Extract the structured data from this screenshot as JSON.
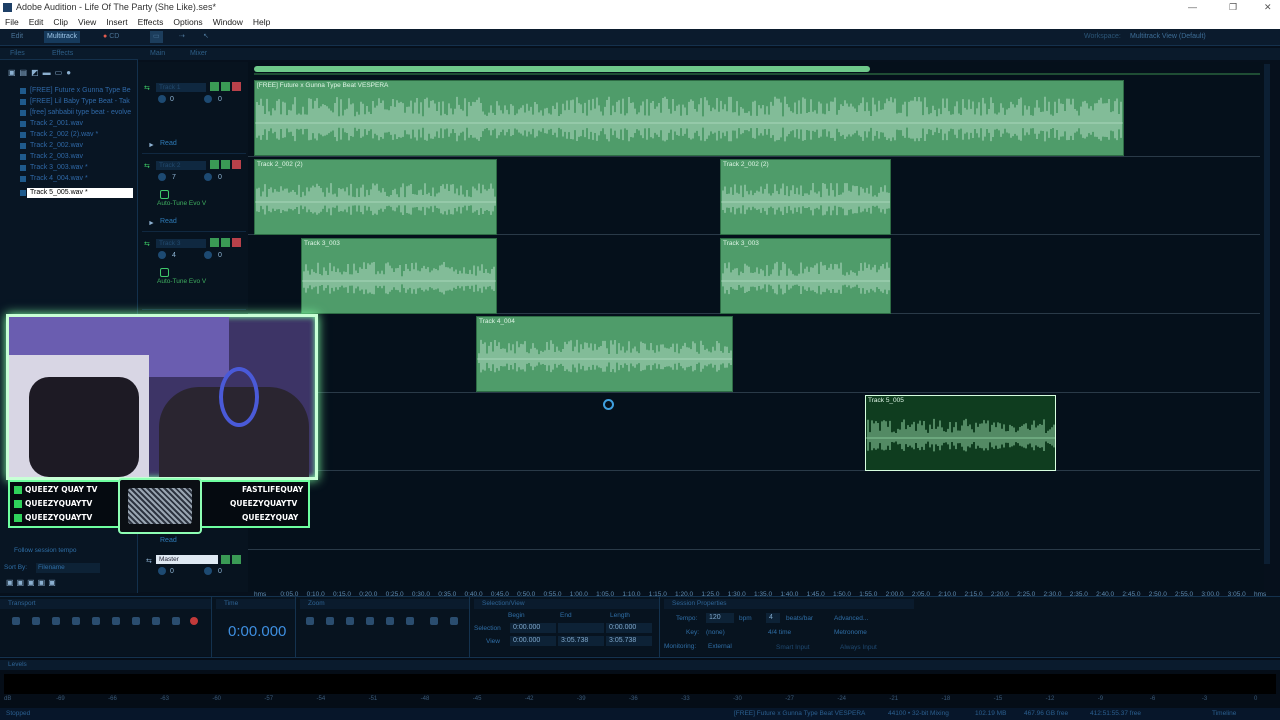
{
  "window": {
    "title": "Adobe Audition - Life Of The Party (She Like).ses*"
  },
  "menu": [
    "File",
    "Edit",
    "Clip",
    "View",
    "Insert",
    "Effects",
    "Options",
    "Window",
    "Help"
  ],
  "toolbar": {
    "edit": "Edit",
    "multitrack": "Multitrack",
    "cd": "CD",
    "workspace_label": "Workspace:",
    "workspace_value": "Multitrack View (Default)"
  },
  "left_panel": {
    "tabs": [
      "Files",
      "Effects"
    ],
    "files": [
      "[FREE] Future x Gunna Type Be",
      "[FREE] Lil Baby Type Beat - Tak",
      "[free] sahbabii type beat - evolve",
      "Track 2_001.wav",
      "Track 2_002 (2).wav *",
      "Track 2_002.wav",
      "Track 2_003.wav",
      "Track 3_003.wav *",
      "Track 4_004.wav *",
      "Track 5_005.wav *"
    ],
    "follow_tempo": "Follow session tempo",
    "sort_by_label": "Sort By:",
    "sort_by_value": "Filename"
  },
  "main_tabs": [
    "Main",
    "Mixer"
  ],
  "tracks": [
    {
      "name": "Track 1",
      "vol": "0",
      "pan": "0",
      "fx": "",
      "read": "Read"
    },
    {
      "name": "Track 2",
      "vol": "7",
      "pan": "0",
      "fx": "Auto-Tune Evo V",
      "read": "Read"
    },
    {
      "name": "Track 3",
      "vol": "4",
      "pan": "0",
      "fx": "Auto-Tune Evo V",
      "read": "Read"
    }
  ],
  "master": {
    "name": "Master",
    "vol": "0",
    "pan": "0",
    "read": "Read"
  },
  "clips": {
    "c1": "[FREE] Future x Gunna Type Beat VESPERA",
    "c2a": "Track 2_002 (2)",
    "c2b": "Track 2_002 (2)",
    "c3a": "Track 3_003",
    "c3b": "Track 3_003",
    "c4": "Track 4_004",
    "c5": "Track 5_005"
  },
  "ruler": [
    "hms",
    "0:05.0",
    "0:10.0",
    "0:15.0",
    "0:20.0",
    "0:25.0",
    "0:30.0",
    "0:35.0",
    "0:40.0",
    "0:45.0",
    "0:50.0",
    "0:55.0",
    "1:00.0",
    "1:05.0",
    "1:10.0",
    "1:15.0",
    "1:20.0",
    "1:25.0",
    "1:30.0",
    "1:35.0",
    "1:40.0",
    "1:45.0",
    "1:50.0",
    "1:55.0",
    "2:00.0",
    "2:05.0",
    "2:10.0",
    "2:15.0",
    "2:20.0",
    "2:25.0",
    "2:30.0",
    "2:35.0",
    "2:40.0",
    "2:45.0",
    "2:50.0",
    "2:55.0",
    "3:00.0",
    "3:05.0",
    "hms"
  ],
  "overlay": {
    "left": [
      "QUEEZY QUAY TV",
      "QUEEZYQUAYTV",
      "QUEEZYQUAYTV"
    ],
    "right": [
      "FASTLIFEQUAY",
      "QUEEZYQUAYTV",
      "QUEEZYQUAY"
    ]
  },
  "transport": {
    "title": "Transport"
  },
  "time": {
    "title": "Time",
    "value": "0:00.000"
  },
  "zoom": {
    "title": "Zoom"
  },
  "selection": {
    "title": "Selection/View",
    "begin": "Begin",
    "end": "End",
    "length": "Length",
    "sel_label": "Selection",
    "view_label": "View",
    "sel_begin": "0:00.000",
    "sel_end": "",
    "sel_length": "0:00.000",
    "view_begin": "0:00.000",
    "view_end": "3:05.738",
    "view_length": "3:05.738"
  },
  "session": {
    "title": "Session Properties",
    "tempo_label": "Tempo:",
    "tempo": "120",
    "bpm": "bpm",
    "beats": "4",
    "beats_label": "beats/bar",
    "advanced": "Advanced...",
    "key_label": "Key:",
    "key": "(none)",
    "time_sig": "4/4 time",
    "metronome": "Metronome",
    "monitoring_label": "Monitoring:",
    "monitoring": "External",
    "smart_input": "Smart Input",
    "always_input": "Always Input"
  },
  "levels": {
    "title": "Levels",
    "scale": [
      "dB",
      "-69",
      "-66",
      "-63",
      "-60",
      "-57",
      "-54",
      "-51",
      "-48",
      "-45",
      "-42",
      "-39",
      "-36",
      "-33",
      "-30",
      "-27",
      "-24",
      "-21",
      "-18",
      "-15",
      "-12",
      "-9",
      "-6",
      "-3",
      "0"
    ]
  },
  "status": {
    "left": "Stopped",
    "file": "[FREE] Future x Gunna Type Beat VESPERA",
    "rate": "44100 • 32-bit Mixing",
    "mem": "102.19 MB",
    "disk": "467.96 GB free",
    "free": "412:51:55.37 free",
    "mode": "Timeline"
  }
}
